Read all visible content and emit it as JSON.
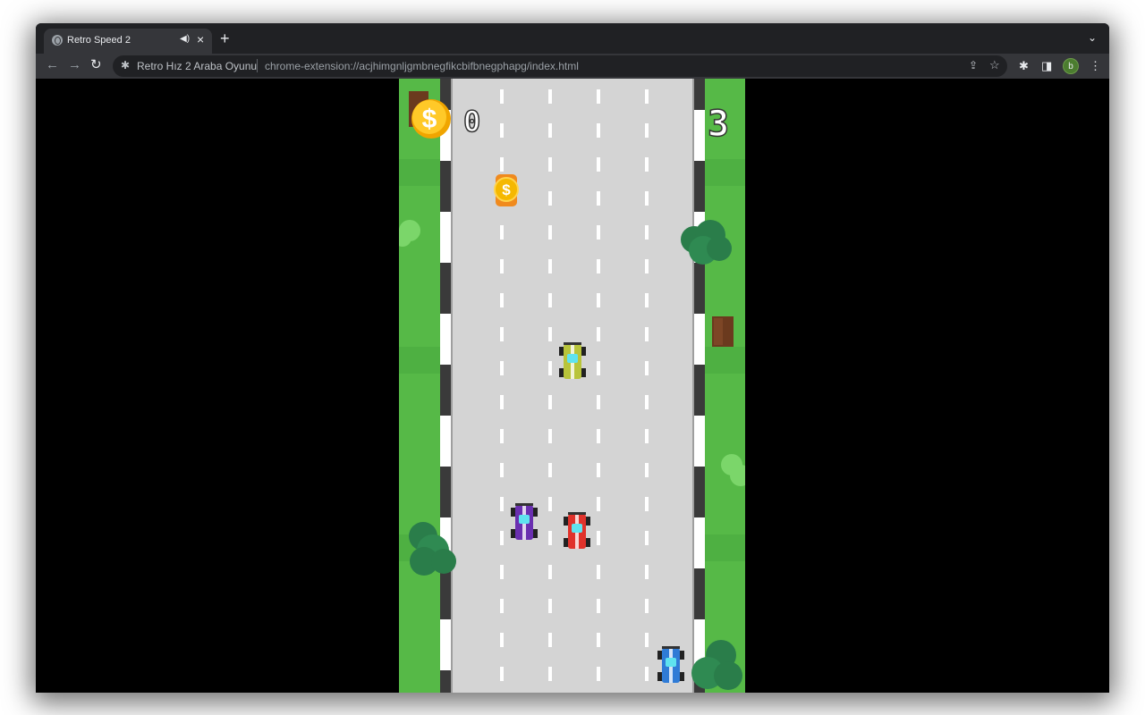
{
  "browser": {
    "tab": {
      "title": "Retro Speed 2",
      "audio_icon": "speaker-icon",
      "close_icon": "close-icon"
    },
    "new_tab_icon": "plus-icon",
    "tab_list_icon": "chevron-down-icon",
    "omnibox": {
      "site_name": "Retro Hız 2 Araba Oyunu",
      "url": "chrome-extension://acjhimgnljgmbnegfikcbifbnegphapg/index.html"
    },
    "profile_initial": "b"
  },
  "game": {
    "coin_count": "0",
    "score": "3",
    "colors": {
      "grass": "#56b947",
      "road": "#d4d4d4",
      "lane": "#ffffff",
      "curb_dark": "#3a3a3a",
      "coin": "#f5b800"
    },
    "cars": [
      {
        "name": "player-car-red",
        "lane": 2,
        "color": "#e0322b"
      },
      {
        "name": "enemy-car-yellow",
        "lane": 2,
        "color": "#b8c43a"
      },
      {
        "name": "enemy-car-purple",
        "lane": 1,
        "color": "#6a2fb0"
      },
      {
        "name": "enemy-car-blue",
        "lane": 4,
        "color": "#2f7bd6"
      }
    ],
    "coins": [
      {
        "name": "road-coin",
        "lane": 1,
        "symbol": "$"
      }
    ]
  }
}
